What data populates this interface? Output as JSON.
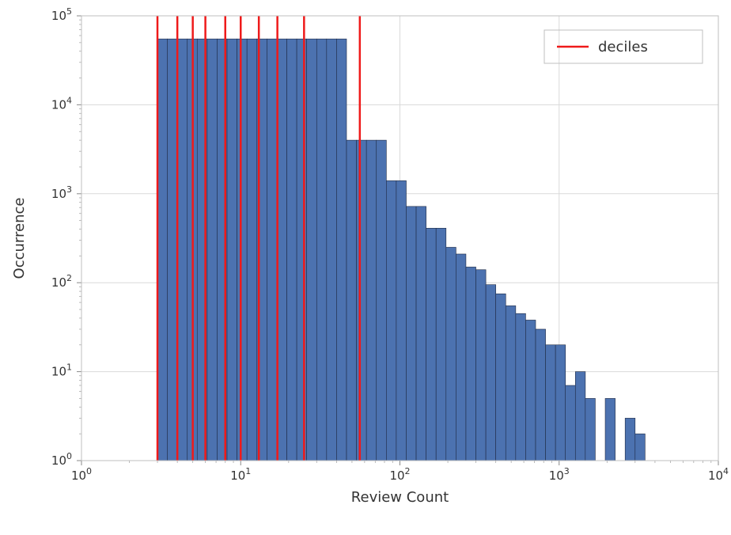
{
  "chart_data": {
    "type": "bar",
    "title": "",
    "xlabel": "Review Count",
    "ylabel": "Occurrence",
    "xscale": "log",
    "yscale": "log",
    "xlim": [
      1,
      10000
    ],
    "ylim": [
      1,
      100000
    ],
    "x_major_ticks": [
      1,
      10,
      100,
      1000,
      10000
    ],
    "x_tick_labels": [
      "10^0",
      "10^1",
      "10^2",
      "10^3",
      "10^4"
    ],
    "y_major_ticks": [
      1,
      10,
      100,
      1000,
      10000,
      100000
    ],
    "y_tick_labels": [
      "10^0",
      "10^1",
      "10^2",
      "10^3",
      "10^4",
      "10^5"
    ],
    "histogram": [
      {
        "x": 3.0,
        "count": 55000
      },
      {
        "x": 3.46,
        "count": 55000
      },
      {
        "x": 4.0,
        "count": 55000
      },
      {
        "x": 4.62,
        "count": 55000
      },
      {
        "x": 5.33,
        "count": 55000
      },
      {
        "x": 6.16,
        "count": 55000
      },
      {
        "x": 7.11,
        "count": 55000
      },
      {
        "x": 8.21,
        "count": 55000
      },
      {
        "x": 9.48,
        "count": 55000
      },
      {
        "x": 10.95,
        "count": 55000
      },
      {
        "x": 12.65,
        "count": 55000
      },
      {
        "x": 14.61,
        "count": 55000
      },
      {
        "x": 16.87,
        "count": 55000
      },
      {
        "x": 19.48,
        "count": 55000
      },
      {
        "x": 22.49,
        "count": 55000
      },
      {
        "x": 25.98,
        "count": 55000
      },
      {
        "x": 30.0,
        "count": 55000
      },
      {
        "x": 34.64,
        "count": 55000
      },
      {
        "x": 40.0,
        "count": 55000
      },
      {
        "x": 46.2,
        "count": 4000
      },
      {
        "x": 53.35,
        "count": 4000
      },
      {
        "x": 61.61,
        "count": 4000
      },
      {
        "x": 71.15,
        "count": 4000
      },
      {
        "x": 82.16,
        "count": 1400
      },
      {
        "x": 94.87,
        "count": 1400
      },
      {
        "x": 109.5,
        "count": 720
      },
      {
        "x": 126.5,
        "count": 720
      },
      {
        "x": 146.0,
        "count": 410
      },
      {
        "x": 168.7,
        "count": 410
      },
      {
        "x": 194.8,
        "count": 250
      },
      {
        "x": 224.9,
        "count": 210
      },
      {
        "x": 259.8,
        "count": 150
      },
      {
        "x": 300.0,
        "count": 140
      },
      {
        "x": 346.4,
        "count": 95
      },
      {
        "x": 400.0,
        "count": 75
      },
      {
        "x": 462.0,
        "count": 55
      },
      {
        "x": 533.5,
        "count": 45
      },
      {
        "x": 616.1,
        "count": 38
      },
      {
        "x": 711.5,
        "count": 30
      },
      {
        "x": 821.6,
        "count": 20
      },
      {
        "x": 948.7,
        "count": 20
      },
      {
        "x": 1095,
        "count": 7
      },
      {
        "x": 1265,
        "count": 10
      },
      {
        "x": 1460,
        "count": 5
      },
      {
        "x": 1687,
        "count": 1
      },
      {
        "x": 1948,
        "count": 5
      },
      {
        "x": 2249,
        "count": 1
      },
      {
        "x": 2598,
        "count": 3
      },
      {
        "x": 3000,
        "count": 2
      },
      {
        "x": 3464,
        "count": 1
      },
      {
        "x": 4620,
        "count": 1
      }
    ],
    "bin_ratio": 1.155,
    "deciles": [
      3.0,
      4.0,
      5.0,
      6.0,
      8.0,
      10.0,
      13.0,
      17.0,
      25.0,
      56.0
    ],
    "legend": {
      "entries": [
        {
          "label": "deciles",
          "line_color": "#ef1a1a"
        }
      ]
    }
  }
}
